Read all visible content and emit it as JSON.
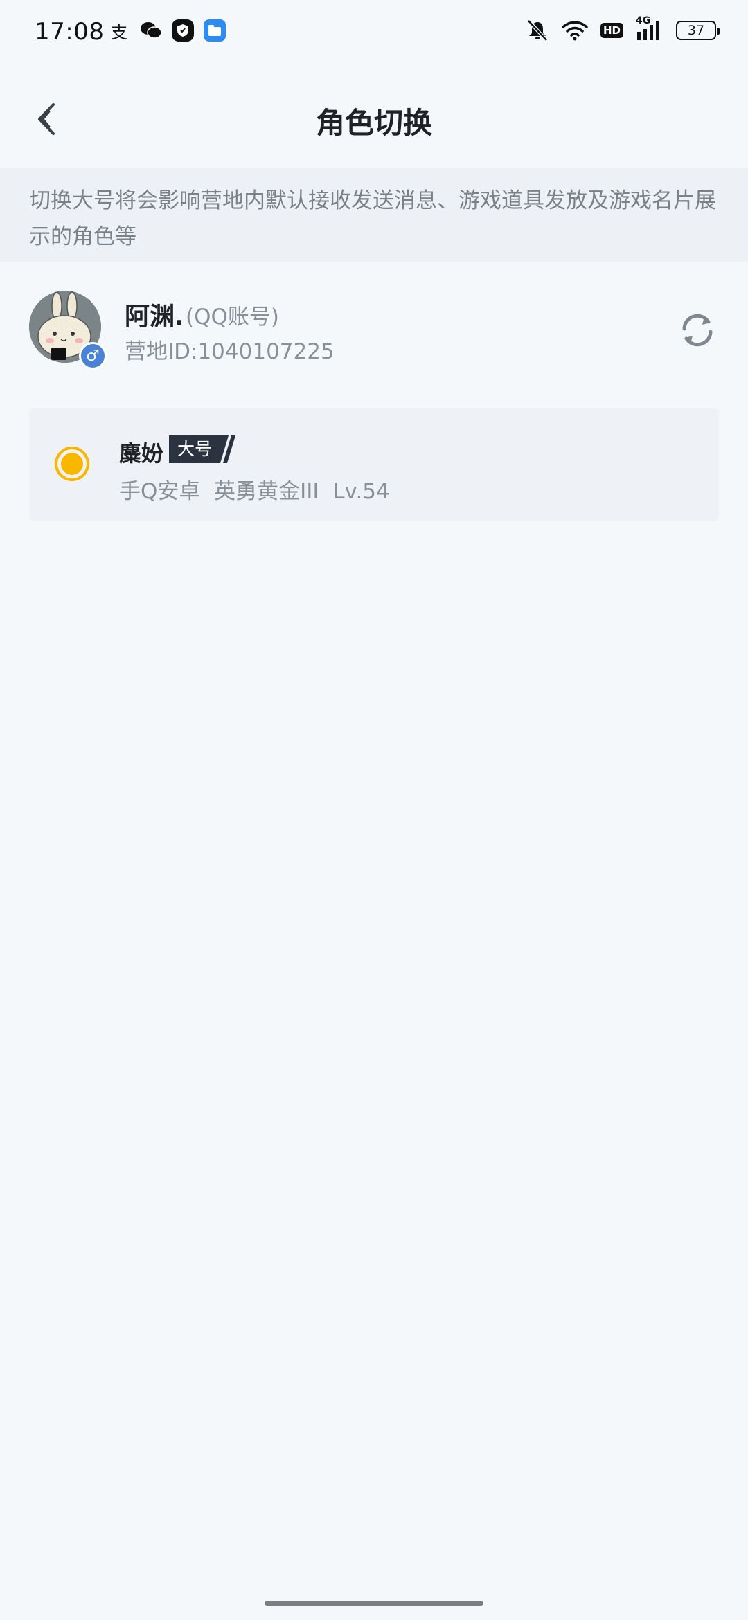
{
  "status_bar": {
    "time": "17:08",
    "app_icons": [
      "alipay-icon",
      "wechat-icon",
      "shield-app-icon",
      "files-app-icon"
    ],
    "hd_label": "HD",
    "network_label": "4G",
    "battery_level": "37"
  },
  "header": {
    "title": "角色切换",
    "back_icon": "chevron-left-icon"
  },
  "notice": {
    "text": "切换大号将会影响营地内默认接收发送消息、游戏道具发放及游戏名片展示的角色等"
  },
  "account": {
    "name": "阿渊.",
    "type": "(QQ账号)",
    "id_text": "营地ID:1040107225",
    "gender_symbol": "♂",
    "switch_icon": "refresh-icon"
  },
  "roles": [
    {
      "name": "麋妢",
      "tag": "大号",
      "detail": "手Q安卓  英勇黄金III  Lv.54",
      "selected": true
    }
  ],
  "colors": {
    "background": "#f5f8fb",
    "notice_bg": "#edf1f5",
    "card_bg": "#eef2f6",
    "radio_accent": "#f9b700",
    "tag_bg": "#2c3340",
    "gender_badge": "#4a83d6"
  }
}
